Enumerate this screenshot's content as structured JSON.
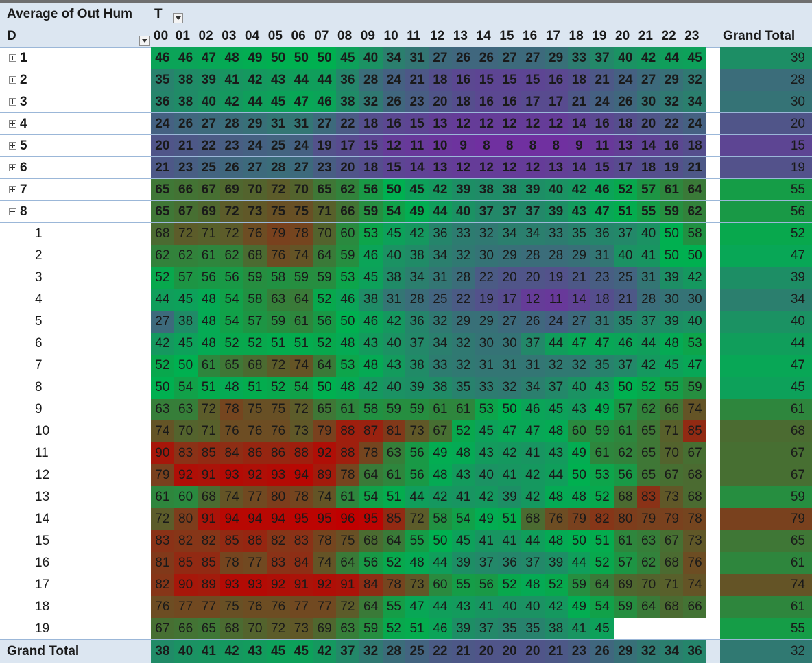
{
  "pivot": {
    "title": "Average of Out Hum",
    "column_field": "T",
    "row_field": "D",
    "grand_total_label": "Grand Total",
    "hours": [
      "00",
      "01",
      "02",
      "03",
      "04",
      "05",
      "06",
      "07",
      "08",
      "09",
      "10",
      "11",
      "12",
      "13",
      "14",
      "15",
      "16",
      "17",
      "18",
      "19",
      "20",
      "21",
      "22",
      "23"
    ],
    "rows": [
      {
        "label": "1",
        "level": 0,
        "toggle": "plus",
        "values": [
          46,
          46,
          47,
          48,
          49,
          50,
          50,
          50,
          45,
          40,
          34,
          31,
          27,
          26,
          26,
          27,
          27,
          29,
          33,
          37,
          40,
          42,
          44,
          45
        ],
        "total": 39
      },
      {
        "label": "2",
        "level": 0,
        "toggle": "plus",
        "values": [
          35,
          38,
          39,
          41,
          42,
          43,
          44,
          44,
          36,
          28,
          24,
          21,
          18,
          16,
          15,
          15,
          15,
          16,
          18,
          21,
          24,
          27,
          29,
          32
        ],
        "total": 28
      },
      {
        "label": "3",
        "level": 0,
        "toggle": "plus",
        "values": [
          36,
          38,
          40,
          42,
          44,
          45,
          47,
          46,
          38,
          32,
          26,
          23,
          20,
          18,
          16,
          16,
          17,
          17,
          21,
          24,
          26,
          30,
          32,
          34
        ],
        "total": 30
      },
      {
        "label": "4",
        "level": 0,
        "toggle": "plus",
        "values": [
          24,
          26,
          27,
          28,
          29,
          31,
          31,
          27,
          22,
          18,
          16,
          15,
          13,
          12,
          12,
          12,
          12,
          12,
          14,
          16,
          18,
          20,
          22,
          24
        ],
        "total": 20
      },
      {
        "label": "5",
        "level": 0,
        "toggle": "plus",
        "values": [
          20,
          21,
          22,
          23,
          24,
          25,
          24,
          19,
          17,
          15,
          12,
          11,
          10,
          9,
          8,
          8,
          8,
          8,
          9,
          11,
          13,
          14,
          16,
          18
        ],
        "total": 15
      },
      {
        "label": "6",
        "level": 0,
        "toggle": "plus",
        "values": [
          21,
          23,
          25,
          26,
          27,
          28,
          27,
          23,
          20,
          18,
          15,
          14,
          13,
          12,
          12,
          12,
          12,
          13,
          14,
          15,
          17,
          18,
          19,
          21
        ],
        "total": 19
      },
      {
        "label": "7",
        "level": 0,
        "toggle": "plus",
        "values": [
          65,
          66,
          67,
          69,
          70,
          72,
          70,
          65,
          62,
          56,
          50,
          45,
          42,
          39,
          38,
          38,
          39,
          40,
          42,
          46,
          52,
          57,
          61,
          64
        ],
        "total": 55
      },
      {
        "label": "8",
        "level": 0,
        "toggle": "minus",
        "values": [
          65,
          67,
          69,
          72,
          73,
          75,
          75,
          71,
          66,
          59,
          54,
          49,
          44,
          40,
          37,
          37,
          37,
          39,
          43,
          47,
          51,
          55,
          59,
          62
        ],
        "total": 56
      },
      {
        "label": "1",
        "level": 1,
        "values": [
          68,
          72,
          71,
          72,
          76,
          79,
          78,
          70,
          60,
          53,
          45,
          42,
          36,
          33,
          32,
          34,
          34,
          33,
          35,
          36,
          37,
          40,
          50,
          58
        ],
        "total": 52
      },
      {
        "label": "2",
        "level": 1,
        "values": [
          62,
          62,
          61,
          62,
          68,
          76,
          74,
          64,
          59,
          46,
          40,
          38,
          34,
          32,
          30,
          29,
          28,
          28,
          29,
          31,
          40,
          41,
          50,
          50
        ],
        "total": 47
      },
      {
        "label": "3",
        "level": 1,
        "values": [
          52,
          57,
          56,
          56,
          59,
          58,
          59,
          59,
          53,
          45,
          38,
          34,
          31,
          28,
          22,
          20,
          20,
          19,
          21,
          23,
          25,
          31,
          39,
          42
        ],
        "total": 39
      },
      {
        "label": "4",
        "level": 1,
        "values": [
          44,
          45,
          48,
          54,
          58,
          63,
          64,
          52,
          46,
          38,
          31,
          28,
          25,
          22,
          19,
          17,
          12,
          11,
          14,
          18,
          21,
          28,
          30,
          30
        ],
        "total": 34
      },
      {
        "label": "5",
        "level": 1,
        "values": [
          27,
          38,
          48,
          54,
          57,
          59,
          61,
          56,
          50,
          46,
          42,
          36,
          32,
          29,
          29,
          27,
          26,
          24,
          27,
          31,
          35,
          37,
          39,
          40
        ],
        "total": 40
      },
      {
        "label": "6",
        "level": 1,
        "values": [
          42,
          45,
          48,
          52,
          52,
          51,
          51,
          52,
          48,
          43,
          40,
          37,
          34,
          32,
          30,
          30,
          37,
          44,
          47,
          47,
          46,
          44,
          48,
          53
        ],
        "total": 44
      },
      {
        "label": "7",
        "level": 1,
        "values": [
          52,
          50,
          61,
          65,
          68,
          72,
          74,
          64,
          53,
          48,
          43,
          38,
          33,
          32,
          31,
          31,
          31,
          32,
          32,
          35,
          37,
          42,
          45,
          47
        ],
        "total": 47
      },
      {
        "label": "8",
        "level": 1,
        "values": [
          50,
          54,
          51,
          48,
          51,
          52,
          54,
          50,
          48,
          42,
          40,
          39,
          38,
          35,
          33,
          32,
          34,
          37,
          40,
          43,
          50,
          52,
          55,
          59
        ],
        "total": 45
      },
      {
        "label": "9",
        "level": 1,
        "values": [
          63,
          63,
          72,
          78,
          75,
          75,
          72,
          65,
          61,
          58,
          59,
          59,
          61,
          61,
          53,
          50,
          46,
          45,
          43,
          49,
          57,
          62,
          66,
          74
        ],
        "total": 61
      },
      {
        "label": "10",
        "level": 1,
        "values": [
          74,
          70,
          71,
          76,
          76,
          76,
          73,
          79,
          88,
          87,
          81,
          73,
          67,
          52,
          45,
          47,
          47,
          48,
          60,
          59,
          61,
          65,
          71,
          85
        ],
        "total": 68
      },
      {
        "label": "11",
        "level": 1,
        "values": [
          90,
          83,
          85,
          84,
          86,
          86,
          88,
          92,
          88,
          78,
          63,
          56,
          49,
          48,
          43,
          42,
          41,
          43,
          49,
          61,
          62,
          65,
          70,
          67
        ],
        "total": 67
      },
      {
        "label": "12",
        "level": 1,
        "values": [
          79,
          92,
          91,
          93,
          92,
          93,
          94,
          89,
          78,
          64,
          61,
          56,
          48,
          43,
          40,
          41,
          42,
          44,
          50,
          53,
          56,
          65,
          67,
          68
        ],
        "total": 67
      },
      {
        "label": "13",
        "level": 1,
        "values": [
          61,
          60,
          68,
          74,
          77,
          80,
          78,
          74,
          61,
          54,
          51,
          44,
          42,
          41,
          42,
          39,
          42,
          48,
          48,
          52,
          68,
          83,
          73,
          68
        ],
        "total": 59
      },
      {
        "label": "14",
        "level": 1,
        "values": [
          72,
          80,
          91,
          94,
          94,
          94,
          95,
          95,
          96,
          95,
          85,
          72,
          58,
          54,
          49,
          51,
          68,
          76,
          79,
          82,
          80,
          79,
          79,
          78
        ],
        "total": 79
      },
      {
        "label": "15",
        "level": 1,
        "values": [
          83,
          82,
          82,
          85,
          86,
          82,
          83,
          78,
          75,
          68,
          64,
          55,
          50,
          45,
          41,
          41,
          44,
          48,
          50,
          51,
          61,
          63,
          67,
          73
        ],
        "total": 65
      },
      {
        "label": "16",
        "level": 1,
        "values": [
          81,
          85,
          85,
          78,
          77,
          83,
          84,
          74,
          64,
          56,
          52,
          48,
          44,
          39,
          37,
          36,
          37,
          39,
          44,
          52,
          57,
          62,
          68,
          76
        ],
        "total": 61
      },
      {
        "label": "17",
        "level": 1,
        "values": [
          82,
          90,
          89,
          93,
          93,
          92,
          91,
          92,
          91,
          84,
          78,
          73,
          60,
          55,
          56,
          52,
          48,
          52,
          59,
          64,
          69,
          70,
          71,
          74
        ],
        "total": 74
      },
      {
        "label": "18",
        "level": 1,
        "values": [
          76,
          77,
          77,
          75,
          76,
          76,
          77,
          77,
          72,
          64,
          55,
          47,
          44,
          43,
          41,
          40,
          40,
          42,
          49,
          54,
          59,
          64,
          68,
          66
        ],
        "total": 61
      },
      {
        "label": "19",
        "level": 1,
        "values": [
          67,
          66,
          65,
          68,
          70,
          72,
          73,
          69,
          63,
          59,
          52,
          51,
          46,
          39,
          37,
          35,
          35,
          38,
          41,
          45,
          null,
          null,
          null,
          null
        ],
        "total": 55
      }
    ],
    "grand_total_row": {
      "values": [
        38,
        40,
        41,
        42,
        43,
        45,
        45,
        42,
        37,
        32,
        28,
        25,
        22,
        21,
        20,
        20,
        20,
        21,
        23,
        26,
        29,
        32,
        34,
        36
      ],
      "total": 32
    }
  },
  "colors": {
    "header_bg": "#dce6f1",
    "low": "#7030a0",
    "mid": "#00b050",
    "high": "#c00000"
  }
}
